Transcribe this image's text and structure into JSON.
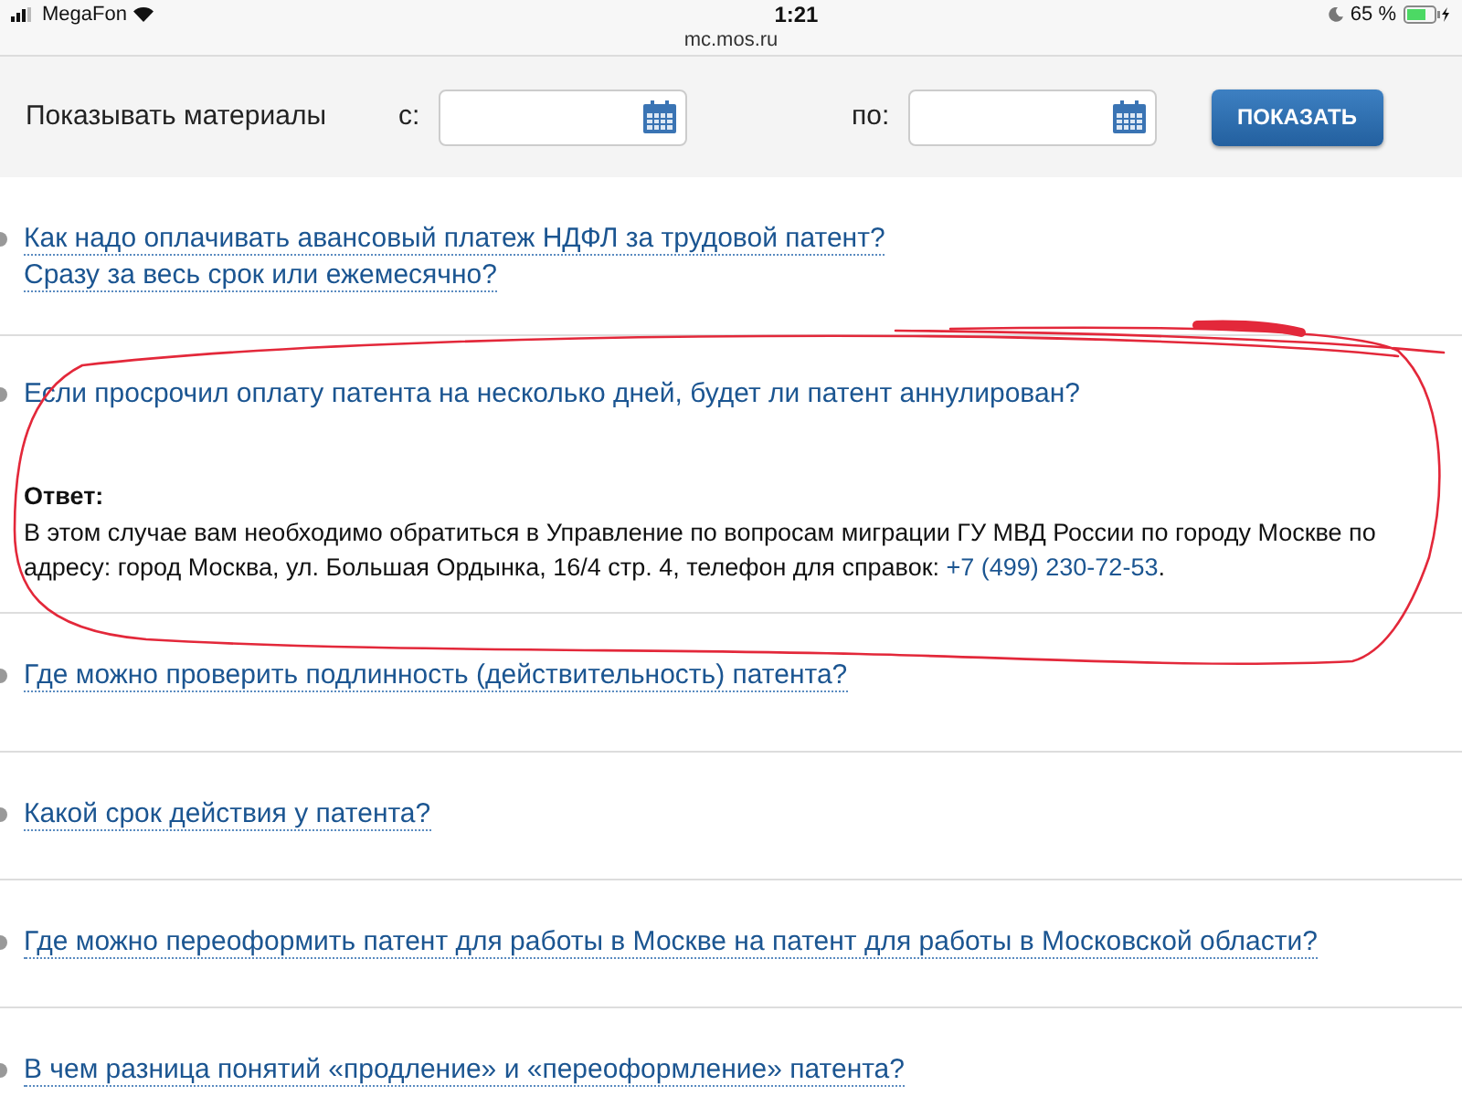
{
  "status_bar": {
    "carrier": "MegaFon",
    "time": "1:21",
    "battery": "65 %",
    "charging": true
  },
  "address": "mc.mos.ru",
  "filter": {
    "label": "Показывать материалы",
    "from_label": "с:",
    "to_label": "по:",
    "button": "ПОКАЗАТЬ"
  },
  "questions": [
    {
      "lines": [
        "Как надо оплачивать авансовый платеж НДФЛ за трудовой патент?",
        "Сразу за весь срок или ежемесячно?"
      ],
      "expanded": false
    },
    {
      "lines": [
        "Если просрочил оплату патента на несколько дней, будет ли патент аннулирован?"
      ],
      "expanded": true,
      "answer": {
        "label": "Ответ:",
        "text": "В этом случае вам необходимо обратиться в Управление по вопросам миграции ГУ МВД России по городу Москве по адресу: город Москва, ул. Большая Ордынка, 16/4 стр. 4, телефон для справок: ",
        "phone": "+7 (499) 230-72-53",
        "end": "."
      }
    },
    {
      "lines": [
        "Где можно проверить подлинность (действительность) патента?"
      ],
      "expanded": false
    },
    {
      "lines": [
        "Какой срок действия у патента?"
      ],
      "expanded": false
    },
    {
      "lines": [
        "Где можно переоформить патент для работы в Москве на патент для работы в Московской области?"
      ],
      "expanded": false
    },
    {
      "lines": [
        "В чем разница понятий «продление» и «переоформление» патента?"
      ],
      "expanded": false
    }
  ],
  "annotation": {
    "kind": "freehand_loop",
    "color": "#e3283a"
  }
}
